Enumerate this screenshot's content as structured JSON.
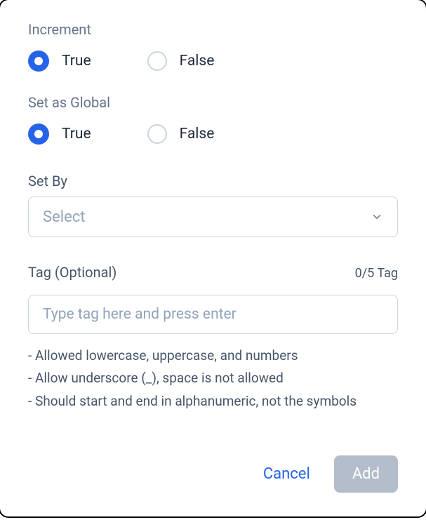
{
  "increment": {
    "label": "Increment",
    "true_label": "True",
    "false_label": "False",
    "selected": "true"
  },
  "global": {
    "label": "Set as Global",
    "true_label": "True",
    "false_label": "False",
    "selected": "true"
  },
  "setby": {
    "label": "Set By",
    "placeholder": "Select"
  },
  "tag": {
    "label": "Tag (Optional)",
    "count": "0/5 Tag",
    "placeholder": "Type tag here and press enter",
    "hints": [
      "- Allowed lowercase, uppercase, and numbers",
      "- Allow underscore (_), space is not allowed",
      "- Should start and end in alphanumeric, not the symbols"
    ]
  },
  "footer": {
    "cancel_label": "Cancel",
    "add_label": "Add"
  }
}
